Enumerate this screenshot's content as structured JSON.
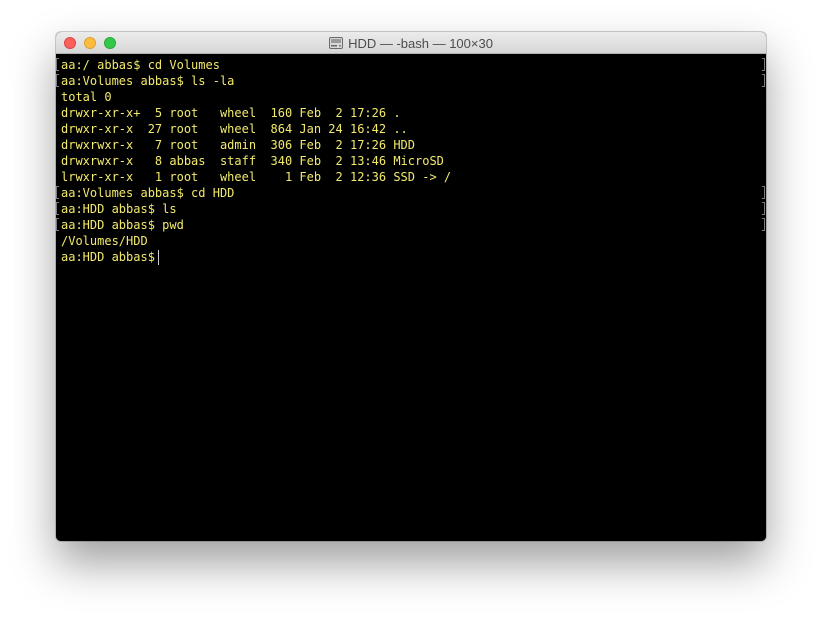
{
  "window": {
    "title": "HDD — -bash — 100×30",
    "title_icon": "disk-icon"
  },
  "terminal": {
    "text_color": "#f2ea6b",
    "background": "#000000",
    "lines": [
      "aa:/ abbas$ cd Volumes",
      "aa:Volumes abbas$ ls -la",
      "total 0",
      "drwxr-xr-x+  5 root   wheel  160 Feb  2 17:26 .",
      "drwxr-xr-x  27 root   wheel  864 Jan 24 16:42 ..",
      "drwxrwxr-x   7 root   admin  306 Feb  2 17:26 HDD",
      "drwxrwxr-x   8 abbas  staff  340 Feb  2 13:46 MicroSD",
      "lrwxr-xr-x   1 root   wheel    1 Feb  2 12:36 SSD -> /",
      "aa:Volumes abbas$ cd HDD",
      "aa:HDD abbas$ ls",
      "aa:HDD abbas$ pwd",
      "/Volumes/HDD",
      "aa:HDD abbas$ "
    ]
  }
}
